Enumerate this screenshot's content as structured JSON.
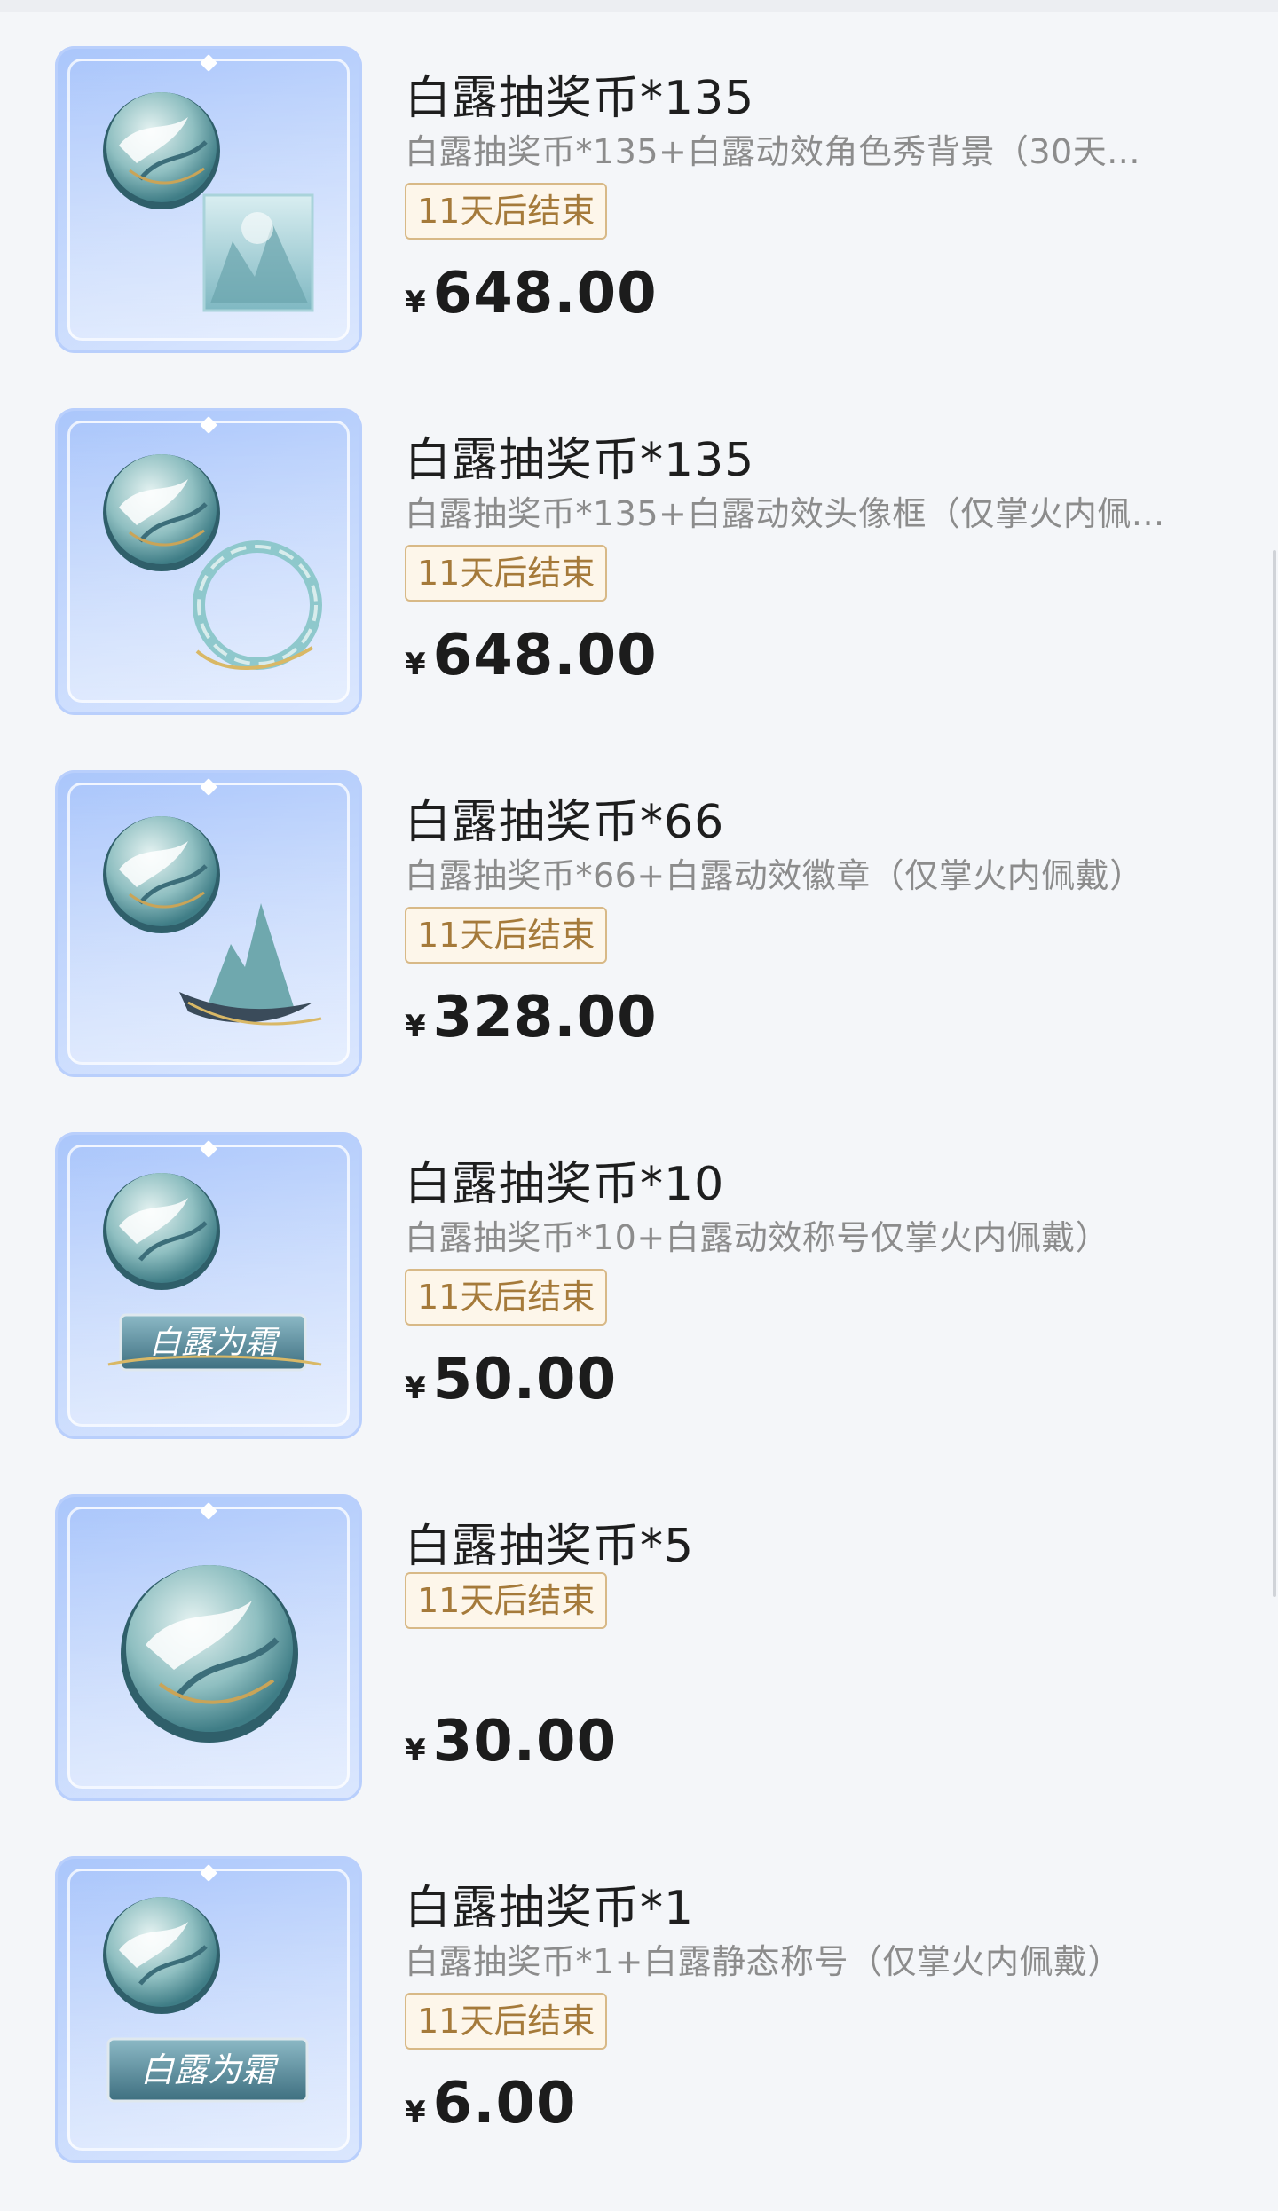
{
  "items": [
    {
      "title": "白露抽奖币*135",
      "desc": "白露抽奖币*135+白露动效角色秀背景（30天...",
      "badge": "11天后结束",
      "currency": "¥",
      "price": "648.00",
      "thumb_icons": [
        "coin-icon",
        "background-scene-icon"
      ]
    },
    {
      "title": "白露抽奖币*135",
      "desc": "白露抽奖币*135+白露动效头像框（仅掌火内佩...",
      "badge": "11天后结束",
      "currency": "¥",
      "price": "648.00",
      "thumb_icons": [
        "coin-icon",
        "avatar-frame-icon"
      ]
    },
    {
      "title": "白露抽奖币*66",
      "desc": "白露抽奖币*66+白露动效徽章（仅掌火内佩戴）",
      "badge": "11天后结束",
      "currency": "¥",
      "price": "328.00",
      "thumb_icons": [
        "coin-icon",
        "crane-badge-icon"
      ]
    },
    {
      "title": "白露抽奖币*10",
      "desc": "白露抽奖币*10+白露动效称号仅掌火内佩戴）",
      "badge": "11天后结束",
      "currency": "¥",
      "price": "50.00",
      "thumb_icons": [
        "coin-icon",
        "title-plaque-icon"
      ],
      "plaque_text": "白露为霜"
    },
    {
      "title": "白露抽奖币*5",
      "desc": "",
      "badge": "11天后结束",
      "currency": "¥",
      "price": "30.00",
      "thumb_icons": [
        "coin-icon"
      ]
    },
    {
      "title": "白露抽奖币*1",
      "desc": "白露抽奖币*1+白露静态称号（仅掌火内佩戴）",
      "badge": "11天后结束",
      "currency": "¥",
      "price": "6.00",
      "thumb_icons": [
        "coin-icon",
        "title-plaque-icon"
      ],
      "plaque_text": "白露为霜"
    }
  ],
  "colors": {
    "badge_border": "#d8b987",
    "badge_text": "#a57a3a",
    "thumb_bg": "#aac6fb",
    "desc_text": "#8c8c8c"
  }
}
